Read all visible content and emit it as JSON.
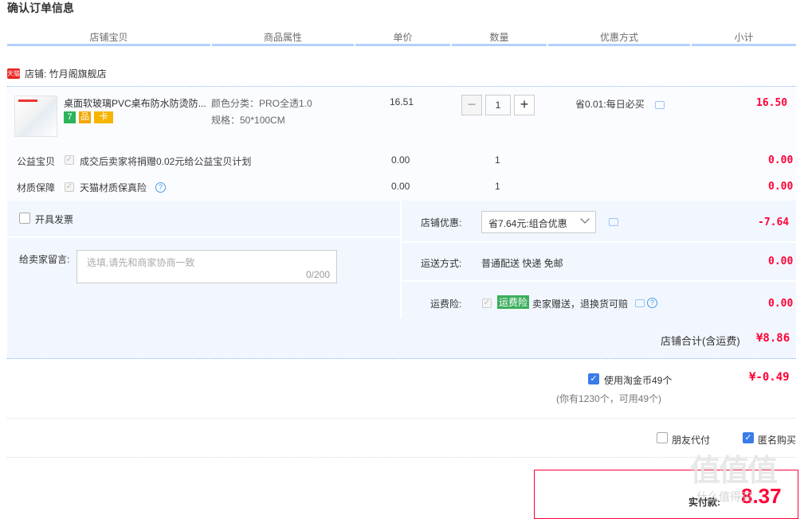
{
  "page_title": "确认订单信息",
  "columns": [
    "店铺宝贝",
    "商品属性",
    "单价",
    "数量",
    "优惠方式",
    "小计"
  ],
  "store": {
    "badge": "天猫",
    "label": "店铺: 竹月阁旗舰店"
  },
  "product": {
    "name": "桌面软玻璃PVC桌布防水防烫防...",
    "attr_color": "颜色分类：PRO全透1.0",
    "attr_size": "规格：50*100CM",
    "unit_price": "16.51",
    "quantity": "1",
    "discount": "省0.01:每日必买",
    "subtotal": "16.50",
    "service_icons": [
      "7",
      "品",
      "卡"
    ]
  },
  "charity": {
    "label": "公益宝贝",
    "text": "成交后卖家将捐赠0.02元给公益宝贝计划",
    "price": "0.00",
    "qty": "1",
    "subtotal": "0.00"
  },
  "material": {
    "label": "材质保障",
    "text": "天猫材质保真险",
    "help": "?",
    "price": "0.00",
    "qty": "1",
    "subtotal": "0.00"
  },
  "invoice": {
    "label": "开具发票"
  },
  "message": {
    "label": "给卖家留言:",
    "placeholder": "选填,请先和商家协商一致",
    "counter": "0/200"
  },
  "store_discount": {
    "label": "店铺优惠:",
    "selected": "省7.64元:组合优惠",
    "amount": "-7.64"
  },
  "shipping": {
    "label": "运送方式:",
    "value": "普通配送 快递 免邮",
    "amount": "0.00"
  },
  "insurance": {
    "label": "运费险:",
    "tag": "运费险",
    "text": "卖家赠送，退换货可赔",
    "help": "?",
    "amount": "0.00"
  },
  "store_total": {
    "label": "店铺合计(含运费)",
    "amount": "¥8.86"
  },
  "coins": {
    "label": "使用淘金币49个",
    "note": "(你有1230个，可用49个)",
    "amount": "¥-0.49"
  },
  "friend_pay": {
    "label": "朋友代付"
  },
  "anonymous": {
    "label": "匿名购买"
  },
  "payment": {
    "label": "实付款:",
    "amount": "8.37"
  },
  "watermark": "值值值",
  "watermark_sub": "什么值得买",
  "colors": {
    "accent_red": "#ff0036",
    "header_line": "#b2d1ff",
    "block_bg": "#f2f7ff",
    "checkbox_blue": "#3a7bea",
    "tag_green": "#3cae5c"
  }
}
